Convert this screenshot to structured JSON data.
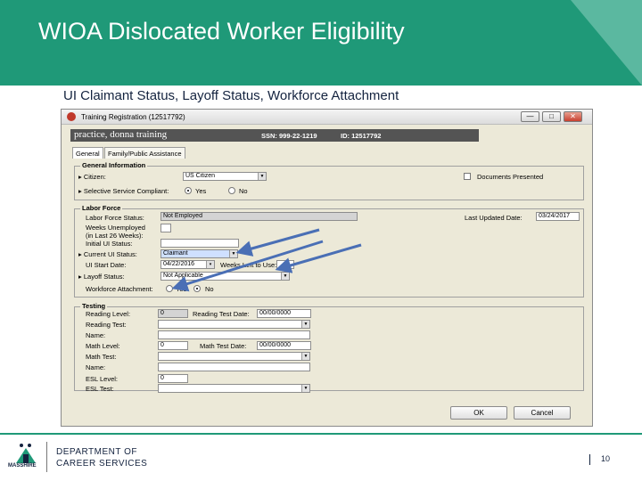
{
  "slide": {
    "title": "WIOA Dislocated Worker Eligibility",
    "subtitle": "UI Claimant Status, Layoff Status, Workforce Attachment",
    "page_number": "10"
  },
  "window": {
    "title": "Training Registration (12517792)",
    "minimize": "—",
    "maximize": "□",
    "close": "✕",
    "participant_name": "practice, donna training",
    "ssn": "SSN:  999-22-1219",
    "id": "ID: 12517792",
    "tabs": [
      "General",
      "Family/Public Assistance"
    ],
    "general_info": {
      "heading": "General Information",
      "citizen_label": "▸ Citizen:",
      "citizen_value": "US Citizen",
      "selective_label": "▸ Selective Service Compliant:",
      "yes_label": "Yes",
      "no_label": "No",
      "docs_label": "Documents Presented"
    },
    "labor_force": {
      "heading": "Labor Force",
      "status_label": "Labor Force Status:",
      "status_value": "Not Employed",
      "weeks_label_1": "Weeks Unemployed",
      "weeks_label_2": "(in Last 26 Weeks):",
      "initial_ui_label": "Initial UI Status:",
      "current_ui_label": "▸ Current UI Status:",
      "current_ui_value": "Claimant",
      "ui_start_label": "UI Start Date:",
      "ui_start_value": "04/22/2016",
      "weeks_left_label": "Weeks Left to Use:",
      "layoff_label": "▸ Layoff Status:",
      "layoff_value": "Not Applicable",
      "workforce_label": "Workforce Attachment:",
      "yes_label": "Yes",
      "no_label": "No",
      "last_updated_label": "Last Updated Date:",
      "last_updated_value": "03/24/2017"
    },
    "testing": {
      "heading": "Testing",
      "reading_level_label": "Reading Level:",
      "reading_level_value": "0",
      "reading_date_label": "Reading Test Date:",
      "reading_date_value": "00/00/0000",
      "reading_test_label": "Reading Test:",
      "name_label_1": "Name:",
      "math_level_label": "Math Level:",
      "math_level_value": "0",
      "math_date_label": "Math Test Date:",
      "math_date_value": "00/00/0000",
      "math_test_label": "Math Test:",
      "name_label_2": "Name:",
      "esl_level_label": "ESL Level:",
      "esl_level_value": "0",
      "esl_test_label": "ESL Test:"
    },
    "buttons": {
      "ok": "OK",
      "cancel": "Cancel"
    }
  },
  "footer": {
    "logo_text": "MASSHIRE",
    "dept_line1": "DEPARTMENT OF",
    "dept_line2": "CAREER SERVICES"
  },
  "colors": {
    "accent": "#1f9978",
    "navy": "#14233f",
    "arrow": "#4a6fb5"
  }
}
